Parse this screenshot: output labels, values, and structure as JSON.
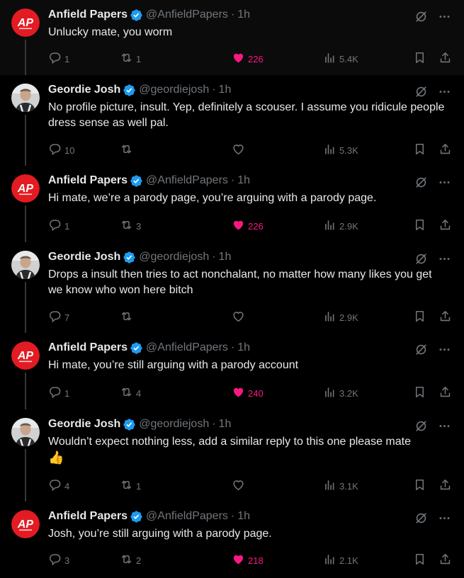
{
  "tweets": [
    {
      "author": "Anfield Papers",
      "handle": "@AnfieldPapers",
      "time": "1h",
      "avatar": "anfield-logo",
      "text": "Unlucky mate, you worm",
      "replies": "1",
      "retweets": "1",
      "likes": "226",
      "liked": true,
      "views": "5.4K"
    },
    {
      "author": "Geordie Josh",
      "handle": "@geordiejosh",
      "time": "1h",
      "avatar": "person-photo",
      "text": "No profile picture, insult. Yep, definitely a scouser. I assume you ridicule people dress sense as well pal.",
      "replies": "10",
      "retweets": "",
      "likes": "",
      "liked": false,
      "views": "5.3K"
    },
    {
      "author": "Anfield Papers",
      "handle": "@AnfieldPapers",
      "time": "1h",
      "avatar": "anfield-logo",
      "text": "Hi mate, we’re a parody page, you’re arguing with a parody page.",
      "replies": "1",
      "retweets": "3",
      "likes": "226",
      "liked": true,
      "views": "2.9K"
    },
    {
      "author": "Geordie Josh",
      "handle": "@geordiejosh",
      "time": "1h",
      "avatar": "person-photo",
      "text": "Drops a insult then tries to act nonchalant, no matter how many likes you get we know who won here bitch",
      "replies": "7",
      "retweets": "",
      "likes": "",
      "liked": false,
      "views": "2.9K"
    },
    {
      "author": "Anfield Papers",
      "handle": "@AnfieldPapers",
      "time": "1h",
      "avatar": "anfield-logo",
      "text": "Hi mate, you’re still arguing with a parody account",
      "replies": "1",
      "retweets": "4",
      "likes": "240",
      "liked": true,
      "views": "3.2K"
    },
    {
      "author": "Geordie Josh",
      "handle": "@geordiejosh",
      "time": "1h",
      "avatar": "person-photo",
      "text": "Wouldn’t expect nothing less, add a similar reply to this one please mate",
      "emoji": "👍",
      "replies": "4",
      "retweets": "1",
      "likes": "",
      "liked": false,
      "views": "3.1K"
    },
    {
      "author": "Anfield Papers",
      "handle": "@AnfieldPapers",
      "time": "1h",
      "avatar": "anfield-logo",
      "text": "Josh, you’re still arguing with a parody page.",
      "replies": "3",
      "retweets": "2",
      "likes": "218",
      "liked": true,
      "views": "2.1K"
    }
  ],
  "anfield_logo_text": "AP",
  "colors": {
    "background": "#000000",
    "text": "#e7e9ea",
    "muted": "#71767b",
    "like": "#f91880",
    "verified": "#1d9bf0",
    "anfield_red": "#e31b23"
  }
}
